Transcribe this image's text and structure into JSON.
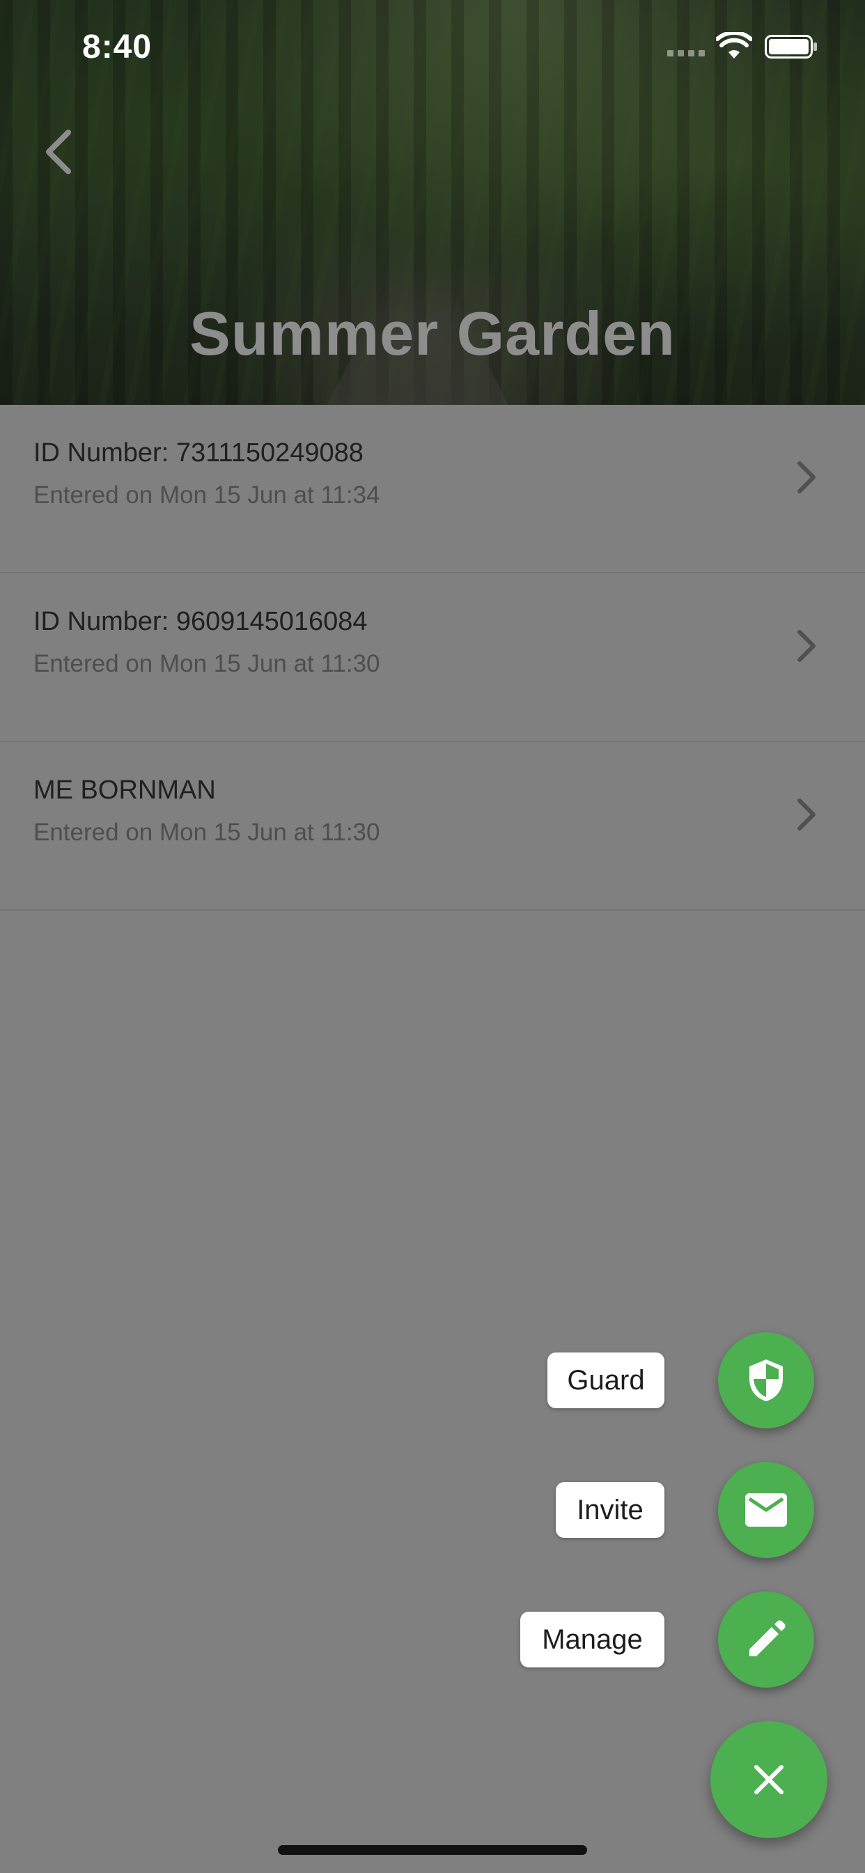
{
  "status_bar": {
    "time": "8:40"
  },
  "header": {
    "title": "Summer Garden",
    "back_icon": "chevron-left-icon"
  },
  "entries": [
    {
      "primary": "ID Number: 7311150249088",
      "secondary": "Entered on Mon 15 Jun at 11:34"
    },
    {
      "primary": "ID Number: 9609145016084",
      "secondary": "Entered on Mon 15 Jun at 11:30"
    },
    {
      "primary": "ME BORNMAN",
      "secondary": "Entered on Mon 15 Jun at 11:30"
    }
  ],
  "fab_menu": {
    "guard_label": "Guard",
    "invite_label": "Invite",
    "manage_label": "Manage",
    "accent_color": "#4caf50",
    "icons": [
      "shield-icon",
      "mail-icon",
      "pencil-icon",
      "close-icon"
    ]
  }
}
